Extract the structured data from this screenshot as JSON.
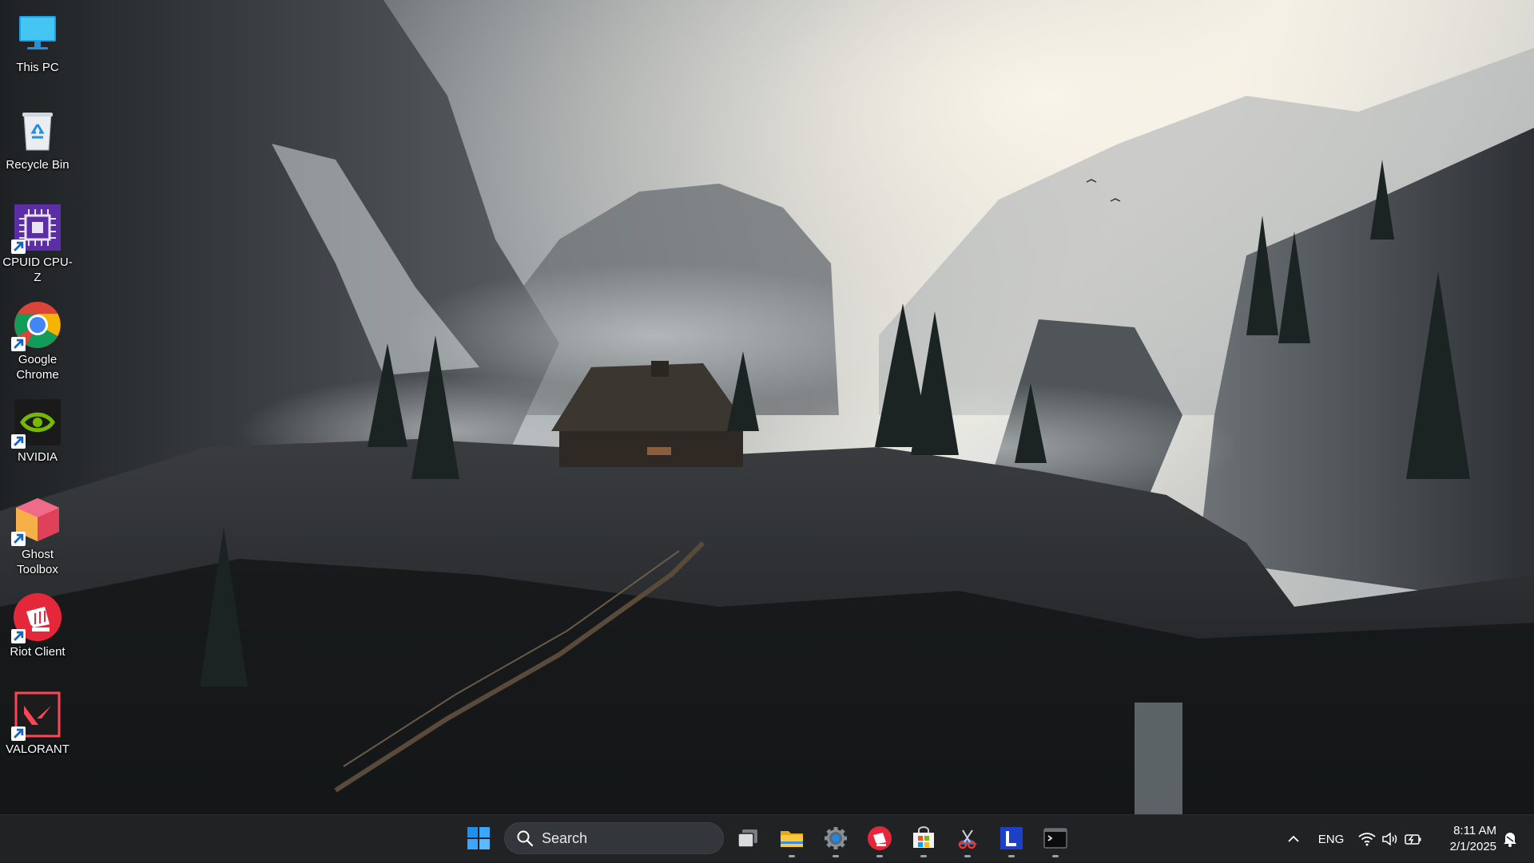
{
  "desktop": {
    "icons": [
      {
        "label": "This PC",
        "icon": "monitor-icon"
      },
      {
        "label": "Recycle Bin",
        "icon": "recycle-bin-icon"
      },
      {
        "label": "CPUID CPU-Z",
        "icon": "cpu-z-icon"
      },
      {
        "label": "Google Chrome",
        "icon": "chrome-icon"
      },
      {
        "label": "NVIDIA",
        "icon": "nvidia-icon"
      },
      {
        "label": "Ghost Toolbox",
        "icon": "ghost-toolbox-icon"
      },
      {
        "label": "Riot Client",
        "icon": "riot-client-icon"
      },
      {
        "label": "VALORANT",
        "icon": "valorant-icon"
      }
    ]
  },
  "taskbar": {
    "search_placeholder": "Search",
    "pinned": [
      {
        "name": "start",
        "icon": "windows-start-icon",
        "running": false
      },
      {
        "name": "task-view",
        "icon": "task-view-icon",
        "running": false
      },
      {
        "name": "file-explorer",
        "icon": "folder-icon",
        "running": true
      },
      {
        "name": "settings",
        "icon": "gear-icon",
        "running": true
      },
      {
        "name": "riot-client",
        "icon": "riot-client-icon",
        "running": true
      },
      {
        "name": "microsoft-store",
        "icon": "store-icon",
        "running": true
      },
      {
        "name": "snipping-tool",
        "icon": "snipping-tool-icon",
        "running": true
      },
      {
        "name": "l-app",
        "icon": "l-app-icon",
        "running": true
      },
      {
        "name": "terminal",
        "icon": "terminal-icon",
        "running": true
      }
    ],
    "tray": {
      "language": "ENG",
      "time": "8:11 AM",
      "date": "2/1/2025"
    }
  },
  "colors": {
    "taskbar_bg": "#202224",
    "riot_red": "#e4283a",
    "nvidia_green": "#76b900",
    "valorant_red": "#fd4556",
    "win_blue": "#1c90f3"
  }
}
